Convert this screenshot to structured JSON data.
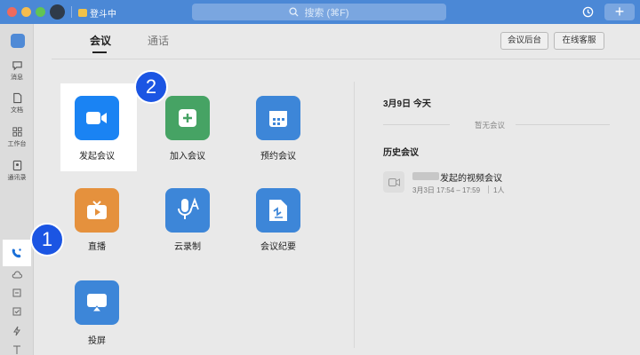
{
  "titlebar": {
    "status": "登斗中",
    "search_placeholder": "搜索 (⌘F)"
  },
  "sidebar": {
    "items": [
      {
        "label": "消息"
      },
      {
        "label": "文档"
      },
      {
        "label": "工作台"
      },
      {
        "label": "通讯录"
      }
    ]
  },
  "tabs": [
    {
      "label": "会议"
    },
    {
      "label": "通话"
    }
  ],
  "header_buttons": {
    "admin": "会议后台",
    "support": "在线客服"
  },
  "actions": [
    {
      "label": "发起会议",
      "color": "#1a83f3"
    },
    {
      "label": "加入会议",
      "color": "#46a364"
    },
    {
      "label": "预约会议",
      "color": "#3d86d8"
    },
    {
      "label": "直播",
      "color": "#e5913d"
    },
    {
      "label": "云录制",
      "color": "#3d86d8"
    },
    {
      "label": "会议纪要",
      "color": "#3d86d8"
    },
    {
      "label": "投屏",
      "color": "#3d86d8"
    }
  ],
  "right": {
    "date": "3月9日  今天",
    "empty": "暂无会议",
    "history_title": "历史会议",
    "history": [
      {
        "title": "发起的视频会议",
        "time": "3月3日 17:54 – 17:59",
        "count": "1人"
      }
    ]
  },
  "badges": {
    "one": "1",
    "two": "2"
  }
}
